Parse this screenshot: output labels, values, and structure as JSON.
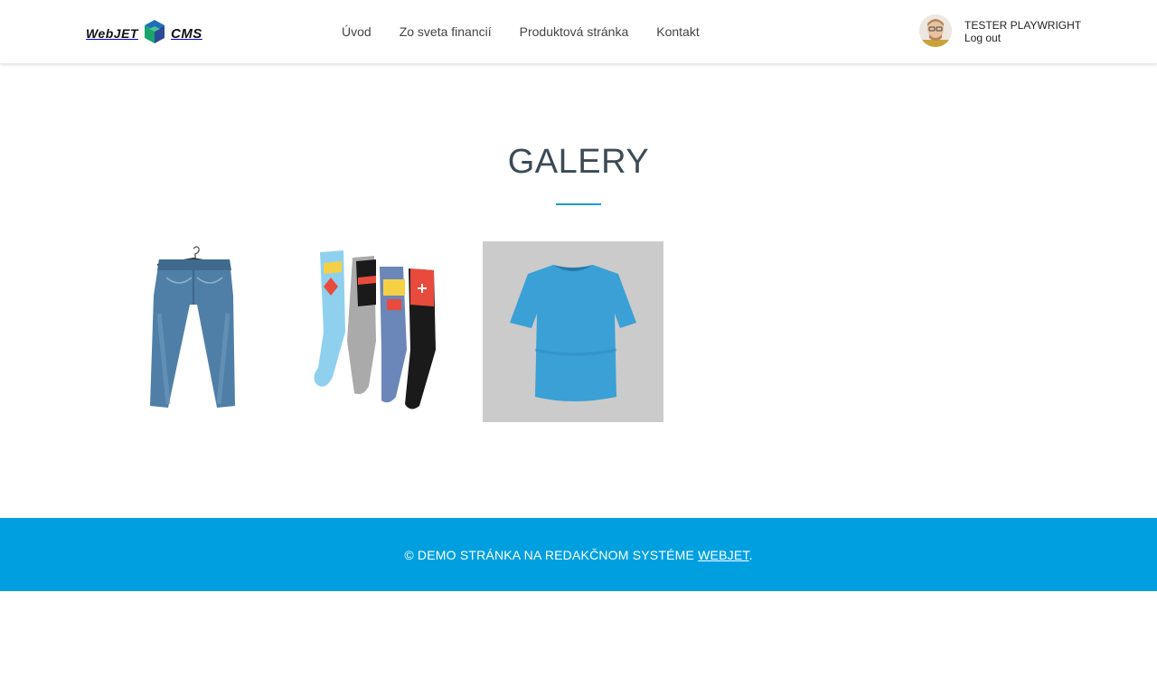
{
  "header": {
    "logo": {
      "left_text": "WebJET",
      "right_text": "CMS"
    },
    "nav": [
      {
        "label": "Úvod"
      },
      {
        "label": "Zo sveta financií"
      },
      {
        "label": "Produktová stránka"
      },
      {
        "label": "Kontakt"
      }
    ],
    "user": {
      "name": "TESTER PLAYWRIGHT",
      "logout_label": "Log out"
    }
  },
  "main": {
    "title": "GALERY",
    "gallery": [
      {
        "item": "jeans"
      },
      {
        "item": "socks"
      },
      {
        "item": "t-shirt"
      }
    ]
  },
  "footer": {
    "prefix": "© DEMO STRÁNKA NA REDAKČNOM SYSTÉME ",
    "link_label": "WEBJET",
    "suffix": "."
  },
  "colors": {
    "accent": "#1e9bd7",
    "footer_bg": "#00a0e0",
    "title": "#3d4a55"
  }
}
